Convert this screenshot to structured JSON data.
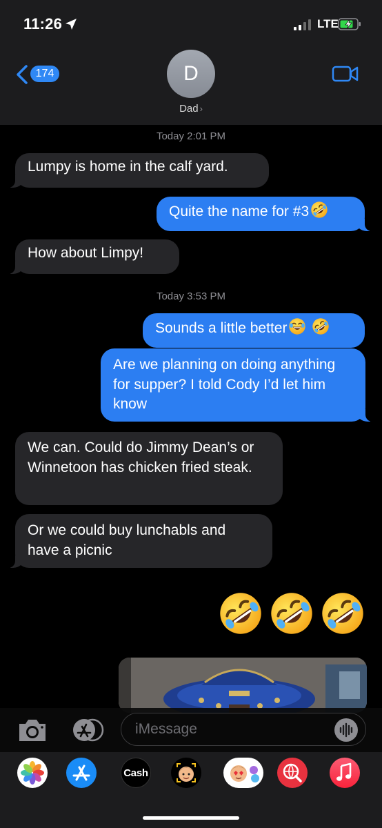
{
  "status_bar": {
    "time": "11:26",
    "network": "LTE",
    "icons": [
      "location-arrow-icon",
      "signal-icon",
      "battery-charging-icon"
    ]
  },
  "header": {
    "back_count": "174",
    "avatar_initial": "D",
    "contact_name": "Dad",
    "icons": [
      "back-chevron-icon",
      "chevron-right-icon",
      "video-camera-icon"
    ]
  },
  "thread": {
    "timestamps": [
      {
        "day": "Today",
        "time": "2:01 PM"
      },
      {
        "day": "Today",
        "time": "3:53 PM"
      }
    ],
    "messages": [
      {
        "from": "incoming",
        "text": "Lumpy is home in the calf yard."
      },
      {
        "from": "outgoing",
        "text": "Quite the name for #3",
        "emoji": [
          "rolling-on-floor-laughing"
        ]
      },
      {
        "from": "incoming",
        "text": "How about Limpy!"
      },
      {
        "from": "outgoing",
        "text": "Sounds a little better",
        "emoji": [
          "tears-of-joy",
          "rolling-on-floor-laughing"
        ]
      },
      {
        "from": "outgoing",
        "text": "Are we planning on doing anything for supper? I told Cody I’d let him know"
      },
      {
        "from": "incoming",
        "text": "We can. Could do Jimmy Dean’s or Winnetoon has chicken fried steak."
      },
      {
        "from": "incoming",
        "text": "Or we could buy lunchabls and have a picnic"
      },
      {
        "from": "outgoing",
        "emoji_only": [
          "rolling-on-floor-laughing",
          "rolling-on-floor-laughing",
          "rolling-on-floor-laughing"
        ]
      },
      {
        "from": "outgoing",
        "type": "image"
      }
    ]
  },
  "input": {
    "placeholder": "iMessage"
  },
  "app_drawer": {
    "apps": [
      "photos",
      "app-store",
      "apple-cash",
      "memoji",
      "memoji-stickers",
      "web-images",
      "music"
    ],
    "cash_label": "Cash"
  },
  "colors": {
    "outgoing": "#2c7ef2",
    "incoming": "#262629",
    "header": "#1c1c1e",
    "badge": "#2f88f5"
  }
}
